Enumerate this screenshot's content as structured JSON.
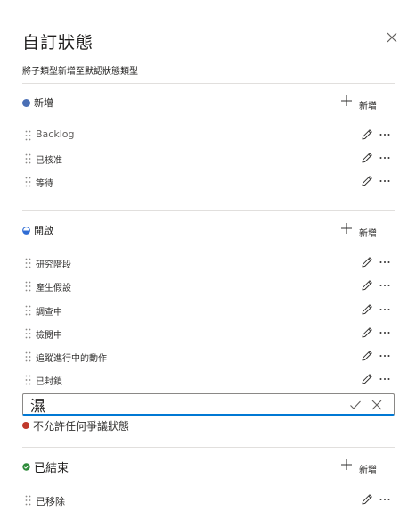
{
  "panel": {
    "title": "自訂狀態",
    "subtitle": "將子類型新增至默認狀態類型"
  },
  "groups": [
    {
      "name": "新增",
      "dot_color": "#4a6fb5",
      "add_label": "新增",
      "items": [
        "Backlog",
        "已核准",
        "等待"
      ]
    },
    {
      "name": "開啟",
      "dot_color": "#2f6cd4",
      "add_label": "新增",
      "items": [
        "研究階段",
        "產生假設",
        "調查中",
        "檢閱中",
        "追蹤進行中的動作",
        "已封鎖"
      ]
    },
    {
      "name": "已結束",
      "dot_color": "#2e8b3a",
      "add_label": "新增",
      "items": [
        "已移除"
      ]
    }
  ],
  "new_item": {
    "value": "濕"
  },
  "validation": {
    "message": "不允許任何爭議狀態",
    "dot_color": "#c0392b"
  },
  "colors": {
    "accent": "#0078d4",
    "divider": "#e1dfdd"
  }
}
